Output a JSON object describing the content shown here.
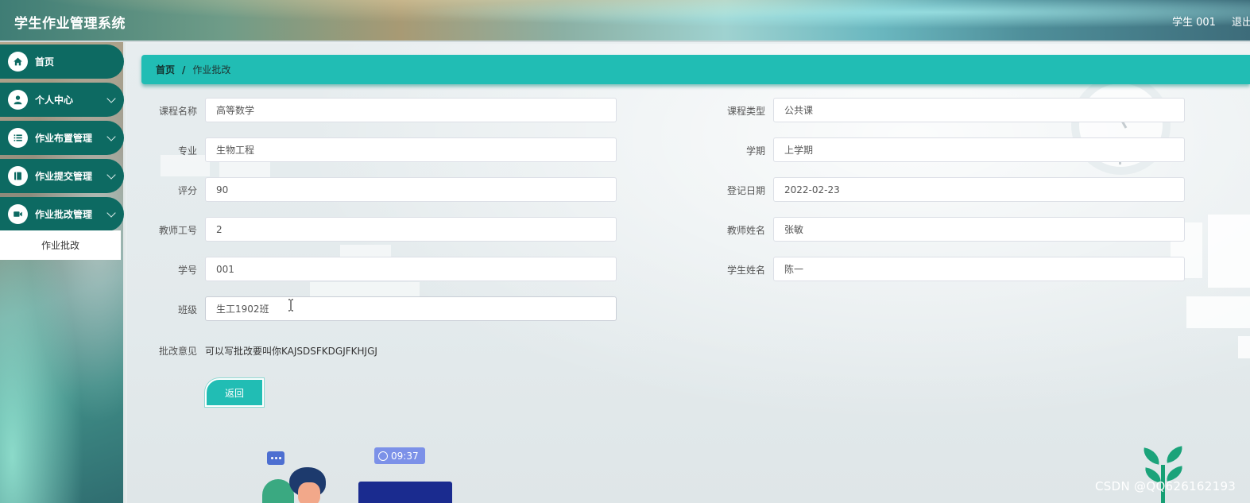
{
  "header": {
    "app_title": "学生作业管理系统",
    "user_label": "学生 001",
    "logout_label": "退出"
  },
  "sidebar": {
    "items": [
      {
        "label": "首页",
        "icon": "home-icon"
      },
      {
        "label": "个人中心",
        "icon": "user-icon"
      },
      {
        "label": "作业布置管理",
        "icon": "list-icon"
      },
      {
        "label": "作业提交管理",
        "icon": "book-icon"
      },
      {
        "label": "作业批改管理",
        "icon": "video-icon"
      }
    ],
    "sub_items": [
      {
        "label": "作业批改"
      }
    ]
  },
  "breadcrumb": {
    "home": "首页",
    "separator": "/",
    "current": "作业批改"
  },
  "form": {
    "course_name": {
      "label": "课程名称",
      "value": "高等数学"
    },
    "course_type": {
      "label": "课程类型",
      "value": "公共课"
    },
    "major": {
      "label": "专业",
      "value": "生物工程"
    },
    "semester": {
      "label": "学期",
      "value": "上学期"
    },
    "score": {
      "label": "评分",
      "value": "90"
    },
    "register_date": {
      "label": "登记日期",
      "value": "2022-02-23"
    },
    "teacher_id": {
      "label": "教师工号",
      "value": "2"
    },
    "teacher_name": {
      "label": "教师姓名",
      "value": "张敏"
    },
    "student_id": {
      "label": "学号",
      "value": "001"
    },
    "student_name": {
      "label": "学生姓名",
      "value": "陈一"
    },
    "class_name": {
      "label": "班级",
      "value": "生工1902班"
    },
    "remark": {
      "label": "批改意见",
      "value": "可以写批改要叫你KAJSDSFKDGJFKHJGJ"
    }
  },
  "actions": {
    "back_label": "返回"
  },
  "illustration": {
    "time": "09:37"
  },
  "watermark": "CSDN @QQ626162193",
  "colors": {
    "accent": "#21bdb4",
    "sidebar_item": "#0d6a62",
    "time_chip": "#7c91e8"
  }
}
